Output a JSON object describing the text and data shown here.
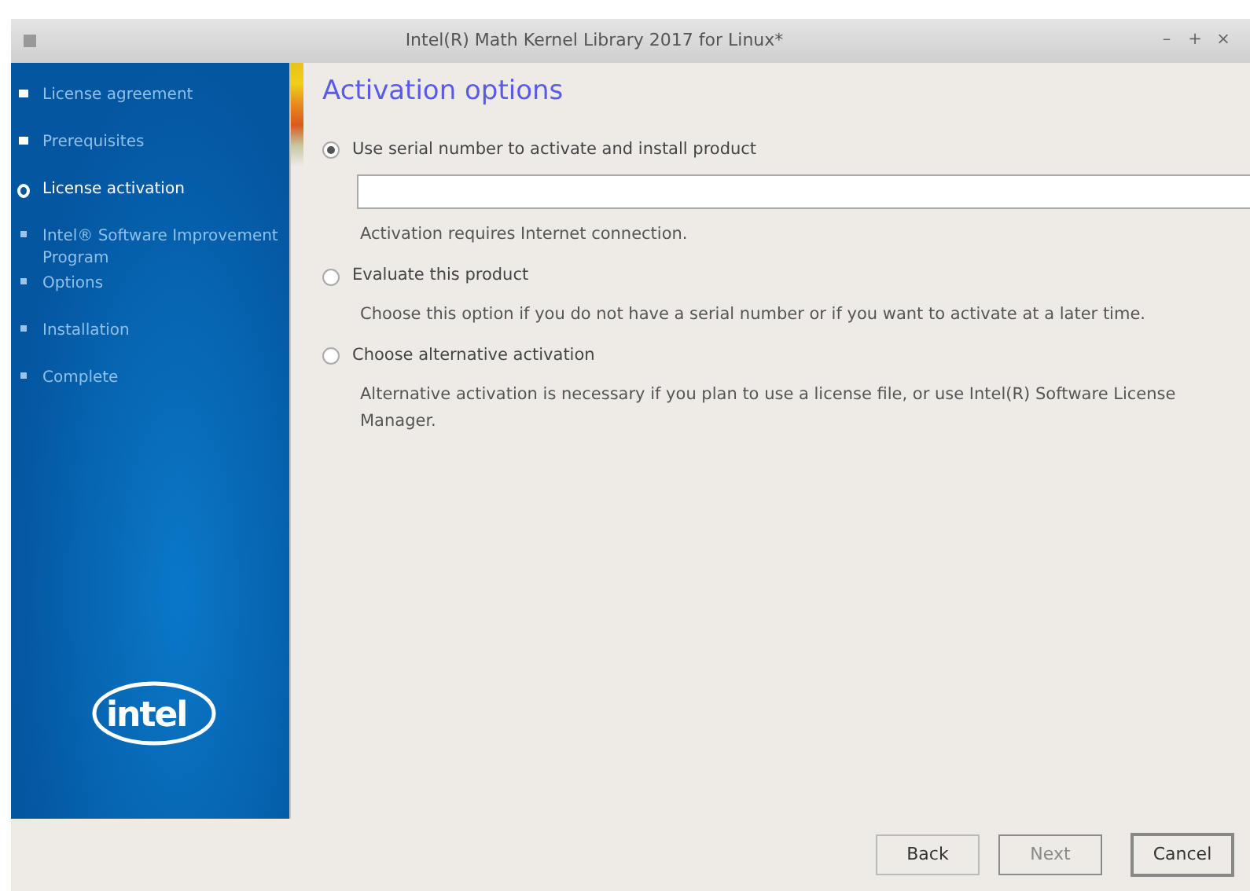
{
  "window": {
    "title": "Intel(R) Math Kernel Library 2017 for Linux*",
    "controls": [
      "–",
      "+",
      "×"
    ]
  },
  "steps": [
    {
      "label": "License agreement",
      "kind": "done"
    },
    {
      "label": "Prerequisites",
      "kind": "done"
    },
    {
      "label": "License activation",
      "kind": "current"
    },
    {
      "label": "Intel® Software Improvement Program",
      "kind": "pending"
    },
    {
      "label": "Options",
      "kind": "pending"
    },
    {
      "label": "Installation",
      "kind": "pending"
    },
    {
      "label": "Complete",
      "kind": "pending"
    }
  ],
  "logo": "intel",
  "heading": "Activation options",
  "options": [
    {
      "label": "Use serial number to activate and install product",
      "selected": true,
      "kind": "field",
      "note": "Activation requires Internet connection."
    },
    {
      "label": "Evaluate this product",
      "selected": false,
      "kind": "plain",
      "note": "Choose this option if you do not have a serial number or if you want to activate at a later time."
    },
    {
      "label": "Choose alternative activation",
      "selected": false,
      "kind": "plain",
      "note": "Alternative activation is necessary if you plan to use a license file, or use Intel(R) Software License Manager."
    }
  ],
  "buttons": [
    {
      "label": "Back",
      "disabled": false,
      "default": false
    },
    {
      "label": "Next",
      "disabled": true,
      "default": false
    },
    {
      "label": "Cancel",
      "disabled": false,
      "default": true
    }
  ]
}
